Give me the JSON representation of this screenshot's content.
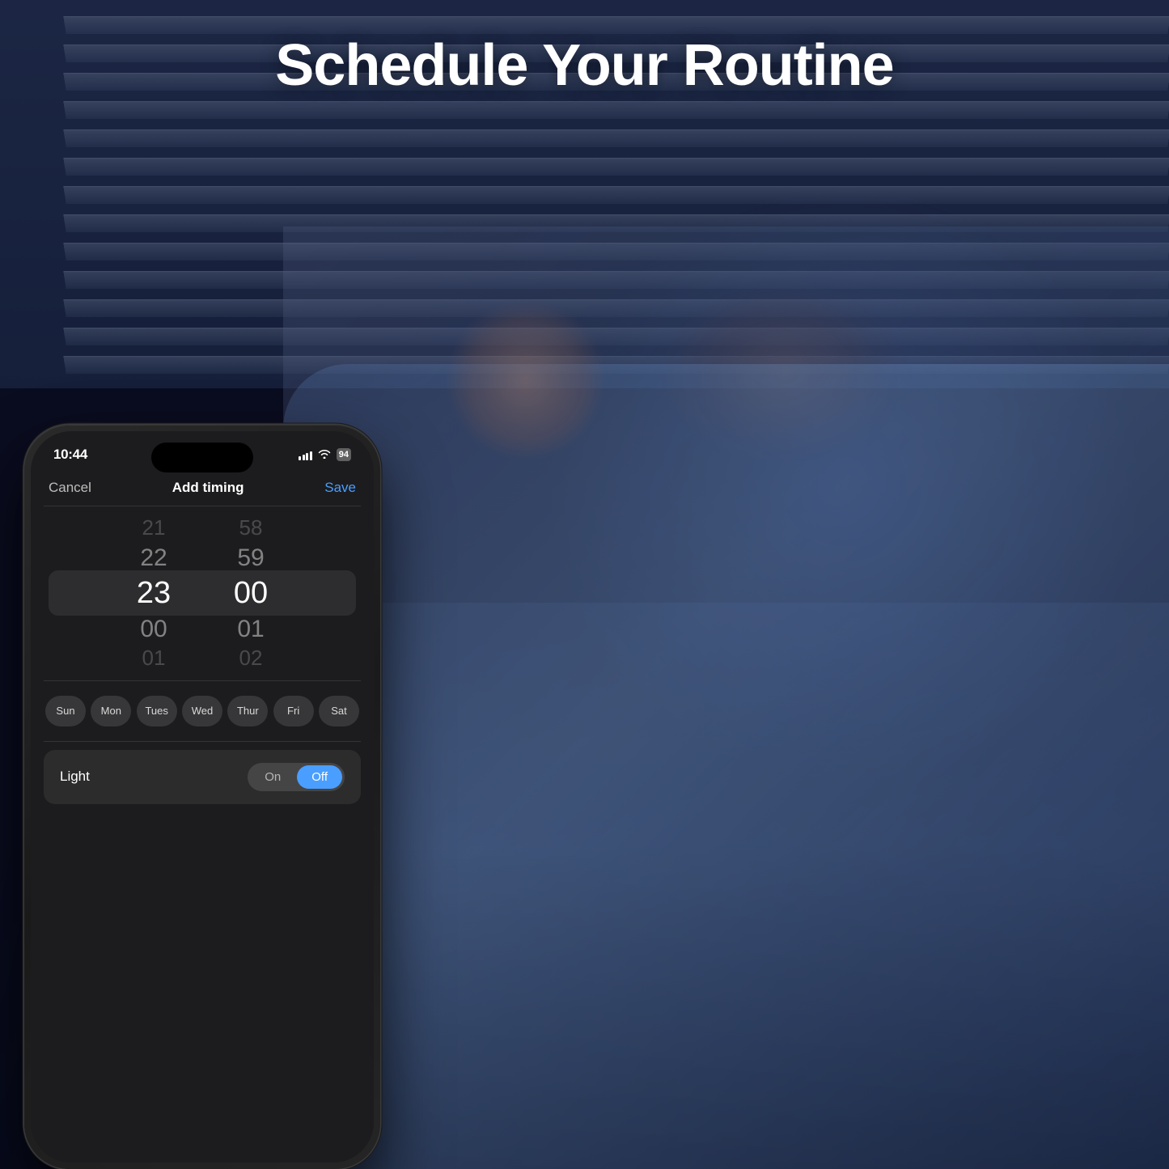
{
  "page": {
    "title": "Schedule Your Routine",
    "background_color": "#0a0f1e"
  },
  "status_bar": {
    "time": "10:44",
    "battery": "94"
  },
  "app": {
    "cancel_label": "Cancel",
    "title_label": "Add timing",
    "save_label": "Save"
  },
  "time_picker": {
    "hours": {
      "prev_prev": "21",
      "prev": "22",
      "selected": "23",
      "next": "00",
      "next_next": "01"
    },
    "minutes": {
      "prev_prev": "58",
      "prev": "59",
      "selected": "00",
      "next": "01",
      "next_next": "02"
    }
  },
  "days": [
    {
      "label": "Sun",
      "selected": false
    },
    {
      "label": "Mon",
      "selected": false
    },
    {
      "label": "Tues",
      "selected": false
    },
    {
      "label": "Wed",
      "selected": false
    },
    {
      "label": "Thur",
      "selected": false
    },
    {
      "label": "Fri",
      "selected": false
    },
    {
      "label": "Sat",
      "selected": false
    }
  ],
  "light_control": {
    "label": "Light",
    "on_label": "On",
    "off_label": "Off",
    "selected": "Off"
  },
  "colors": {
    "accent_blue": "#4a9eff",
    "toggle_active": "#4a9eff"
  }
}
